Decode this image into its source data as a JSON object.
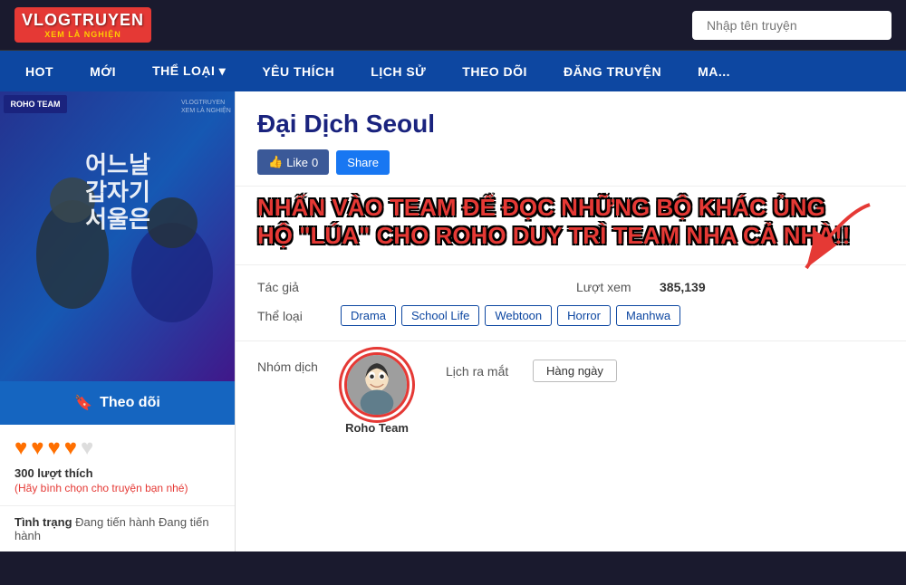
{
  "logo": {
    "title": "VLOGTRUYEN",
    "subtitle": "XEM LÀ NGHIỆN"
  },
  "search": {
    "placeholder": "Nhập tên truyện"
  },
  "nav": {
    "items": [
      {
        "label": "HOT",
        "id": "hot"
      },
      {
        "label": "MỚI",
        "id": "moi"
      },
      {
        "label": "THỂ LOẠI ▾",
        "id": "the-loai"
      },
      {
        "label": "YÊU THÍCH",
        "id": "yeu-thich"
      },
      {
        "label": "LỊCH SỬ",
        "id": "lich-su"
      },
      {
        "label": "THEO DÕI",
        "id": "theo-doi"
      },
      {
        "label": "ĐĂNG TRUYỆN",
        "id": "dang-truyen"
      },
      {
        "label": "MA...",
        "id": "ma"
      }
    ]
  },
  "manga": {
    "title": "Đại Dịch Seoul",
    "cover_label": "어느날 갑자기 서울은",
    "roho_label": "ROHO TEAM",
    "like_count": "0",
    "like_label": "Like",
    "share_label": "Share",
    "promo_text": "NHẤN VÀO TEAM ĐỂ ĐỌC NHỮNG BỘ KHÁC ỦNG HỘ \"LÚA\" CHO ROHO DUY TRÌ TEAM NHA CẢ NHÀ!!",
    "author_label": "Tác giả",
    "author_value": "",
    "views_label": "Lượt xem",
    "views_value": "385,139",
    "genre_label": "Thể loại",
    "genres": [
      "Drama",
      "School Life",
      "Webtoon",
      "Horror",
      "Manhwa"
    ],
    "translator_label": "Nhóm dịch",
    "translator_name": "Roho Team",
    "release_label": "Lịch ra mắt",
    "release_value": "Hàng ngày",
    "follow_label": "Theo dõi",
    "rating_count": "300 lượt thích",
    "rating_hint": "(Hãy bình chọn cho truyện bạn nhé)",
    "status_label": "Tình trạng",
    "status_value": "Đang tiến hành"
  }
}
